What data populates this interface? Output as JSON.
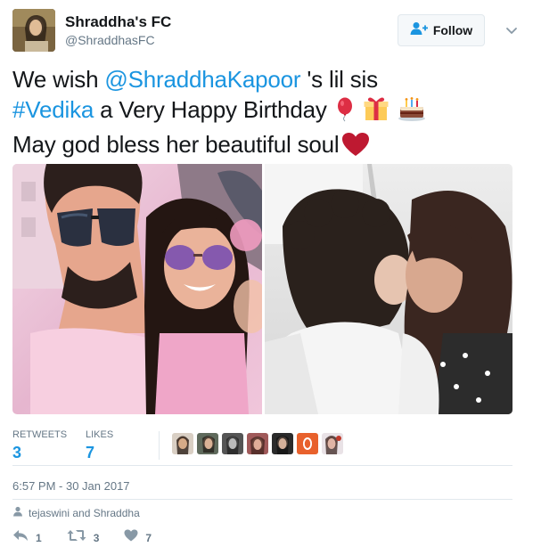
{
  "account": {
    "display_name": "Shraddha's FC",
    "handle": "@ShraddhasFC",
    "follow_label": "Follow"
  },
  "tweet": {
    "line1_prefix": "We wish ",
    "mention": "@ShraddhaKapoor",
    "line1_suffix": " 's lil sis",
    "hashtag": "#Vedika",
    "line2_suffix": " a Very Happy Birthday",
    "line3": "May god bless her beautiful soul",
    "emojis": [
      "balloon-emoji",
      "gift-emoji",
      "cake-emoji",
      "heart-emoji"
    ]
  },
  "stats": {
    "retweets_label": "RETWEETS",
    "retweets_count": "3",
    "likes_label": "LIKES",
    "likes_count": "7",
    "liker_count": 7
  },
  "timestamp": "6:57 PM - 30 Jan 2017",
  "context": "tejaswini and Shraddha",
  "actions": {
    "reply_count": "1",
    "retweet_count": "3",
    "like_count": "7"
  },
  "colors": {
    "link": "#1b95e0",
    "text": "#14171a",
    "muted": "#657786",
    "border": "#e1e8ed"
  }
}
